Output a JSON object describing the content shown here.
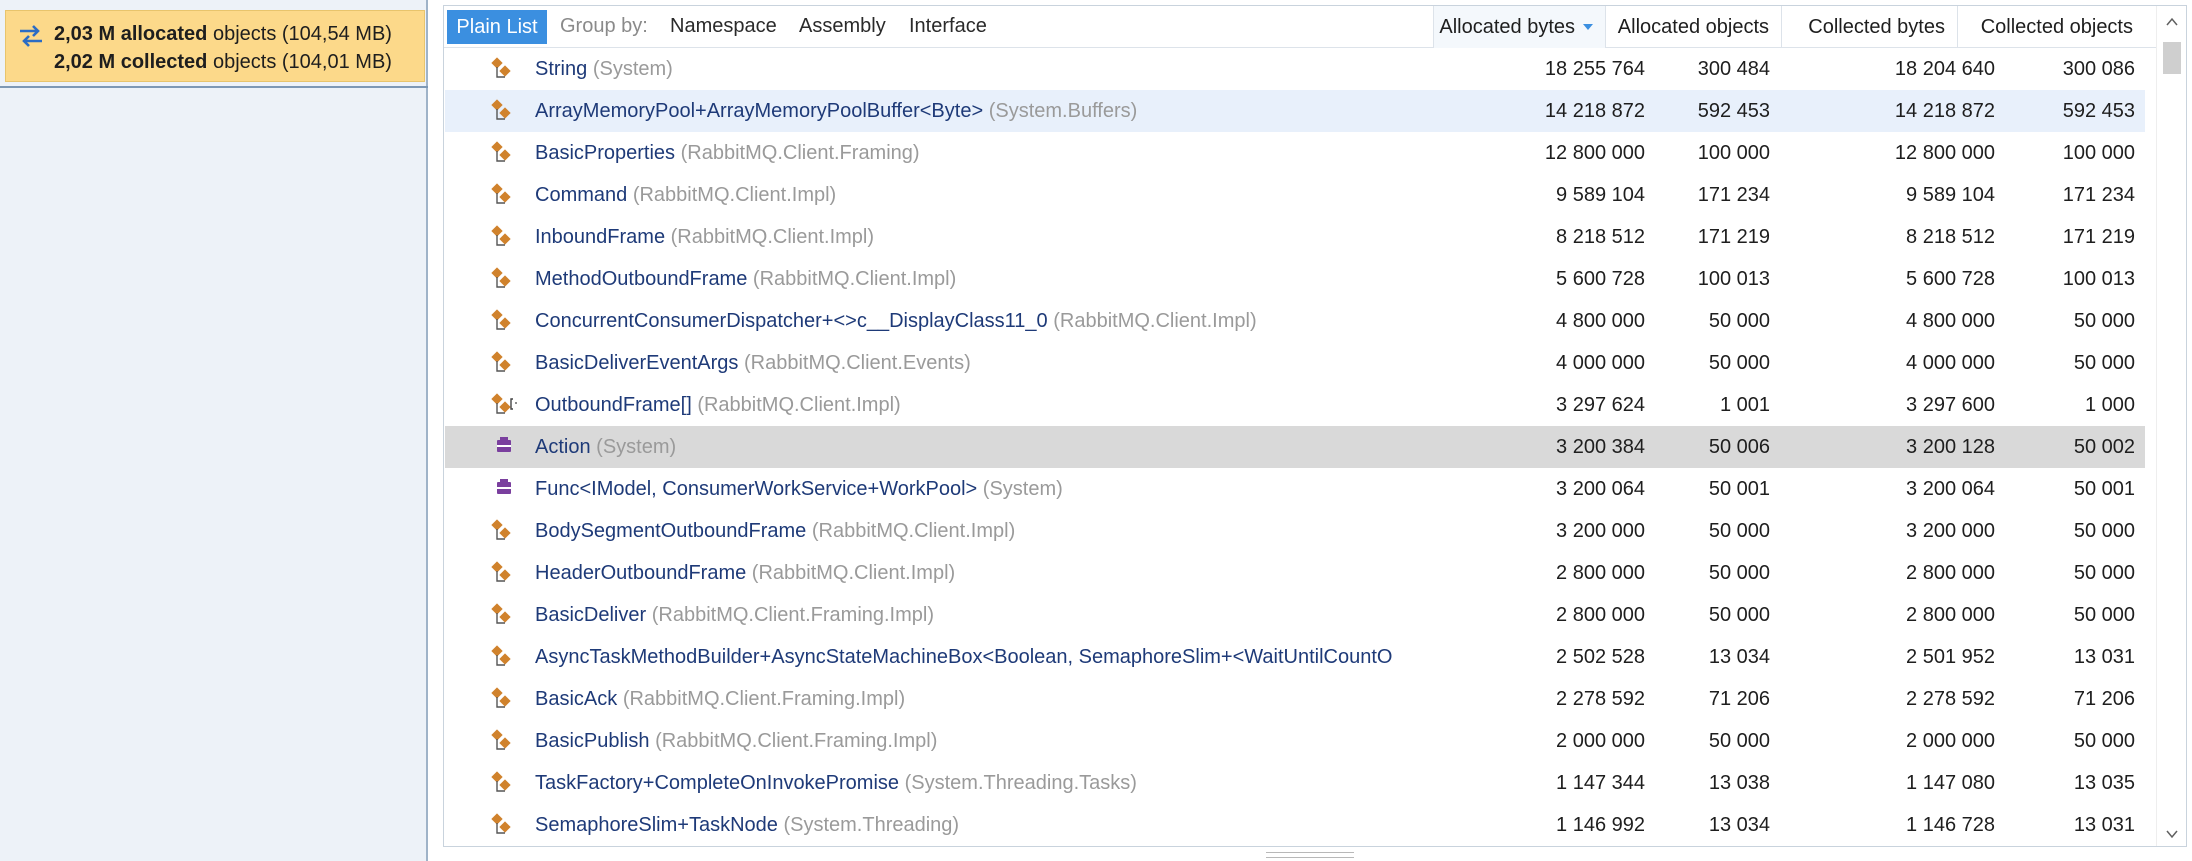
{
  "summary": {
    "allocated_count": "2,03 M allocated",
    "allocated_rest": " objects (104,54 MB)",
    "collected_count": "2,02 M collected",
    "collected_rest": " objects (104,01 MB)"
  },
  "toolbar": {
    "plain_list": "Plain List",
    "group_by": "Group by:",
    "namespace": "Namespace",
    "assembly": "Assembly",
    "interface": "Interface"
  },
  "columns": {
    "allocated_bytes": "Allocated bytes",
    "allocated_objects": "Allocated objects",
    "collected_bytes": "Collected bytes",
    "collected_objects": "Collected objects"
  },
  "colors": {
    "accent": "#3b8fe0",
    "summary_bg": "#fcd98a",
    "selected_row": "#d9d9d9",
    "hover_row": "#e8f0fb",
    "class_icon": "#d0822c",
    "delegate_icon": "#7a3f9e"
  },
  "rows": [
    {
      "name": "String",
      "ns": "(System)",
      "ab": "18 255 764",
      "ao": "300 484",
      "cb": "18 204 640",
      "co": "300 086",
      "icon": "class-icon"
    },
    {
      "name": "ArrayMemoryPool+ArrayMemoryPoolBuffer<Byte>",
      "ns": "(System.Buffers)",
      "ab": "14 218 872",
      "ao": "592 453",
      "cb": "14 218 872",
      "co": "592 453",
      "icon": "class-icon"
    },
    {
      "name": "BasicProperties",
      "ns": "(RabbitMQ.Client.Framing)",
      "ab": "12 800 000",
      "ao": "100 000",
      "cb": "12 800 000",
      "co": "100 000",
      "icon": "class-icon"
    },
    {
      "name": "Command",
      "ns": "(RabbitMQ.Client.Impl)",
      "ab": "9 589 104",
      "ao": "171 234",
      "cb": "9 589 104",
      "co": "171 234",
      "icon": "class-icon"
    },
    {
      "name": "InboundFrame",
      "ns": "(RabbitMQ.Client.Impl)",
      "ab": "8 218 512",
      "ao": "171 219",
      "cb": "8 218 512",
      "co": "171 219",
      "icon": "class-icon"
    },
    {
      "name": "MethodOutboundFrame",
      "ns": "(RabbitMQ.Client.Impl)",
      "ab": "5 600 728",
      "ao": "100 013",
      "cb": "5 600 728",
      "co": "100 013",
      "icon": "class-icon"
    },
    {
      "name": "ConcurrentConsumerDispatcher+<>c__DisplayClass11_0",
      "ns": "(RabbitMQ.Client.Impl)",
      "ab": "4 800 000",
      "ao": "50 000",
      "cb": "4 800 000",
      "co": "50 000",
      "icon": "class-icon"
    },
    {
      "name": "BasicDeliverEventArgs",
      "ns": "(RabbitMQ.Client.Events)",
      "ab": "4 000 000",
      "ao": "50 000",
      "cb": "4 000 000",
      "co": "50 000",
      "icon": "class-icon"
    },
    {
      "name": "OutboundFrame[]",
      "ns": "(RabbitMQ.Client.Impl)",
      "ab": "3 297 624",
      "ao": "1 001",
      "cb": "3 297 600",
      "co": "1 000",
      "icon": "array-icon"
    },
    {
      "name": "Action",
      "ns": "(System)",
      "ab": "3 200 384",
      "ao": "50 006",
      "cb": "3 200 128",
      "co": "50 002",
      "icon": "delegate-icon"
    },
    {
      "name": "Func<IModel, ConsumerWorkService+WorkPool>",
      "ns": "(System)",
      "ab": "3 200 064",
      "ao": "50 001",
      "cb": "3 200 064",
      "co": "50 001",
      "icon": "delegate-icon"
    },
    {
      "name": "BodySegmentOutboundFrame",
      "ns": "(RabbitMQ.Client.Impl)",
      "ab": "3 200 000",
      "ao": "50 000",
      "cb": "3 200 000",
      "co": "50 000",
      "icon": "class-icon"
    },
    {
      "name": "HeaderOutboundFrame",
      "ns": "(RabbitMQ.Client.Impl)",
      "ab": "2 800 000",
      "ao": "50 000",
      "cb": "2 800 000",
      "co": "50 000",
      "icon": "class-icon"
    },
    {
      "name": "BasicDeliver",
      "ns": "(RabbitMQ.Client.Framing.Impl)",
      "ab": "2 800 000",
      "ao": "50 000",
      "cb": "2 800 000",
      "co": "50 000",
      "icon": "class-icon"
    },
    {
      "name": "AsyncTaskMethodBuilder+AsyncStateMachineBox<Boolean, SemaphoreSlim+<WaitUntilCountO",
      "ns": "",
      "ab": "2 502 528",
      "ao": "13 034",
      "cb": "2 501 952",
      "co": "13 031",
      "icon": "class-icon"
    },
    {
      "name": "BasicAck",
      "ns": "(RabbitMQ.Client.Framing.Impl)",
      "ab": "2 278 592",
      "ao": "71 206",
      "cb": "2 278 592",
      "co": "71 206",
      "icon": "class-icon"
    },
    {
      "name": "BasicPublish",
      "ns": "(RabbitMQ.Client.Framing.Impl)",
      "ab": "2 000 000",
      "ao": "50 000",
      "cb": "2 000 000",
      "co": "50 000",
      "icon": "class-icon"
    },
    {
      "name": "TaskFactory+CompleteOnInvokePromise",
      "ns": "(System.Threading.Tasks)",
      "ab": "1 147 344",
      "ao": "13 038",
      "cb": "1 147 080",
      "co": "13 035",
      "icon": "class-icon"
    },
    {
      "name": "SemaphoreSlim+TaskNode",
      "ns": "(System.Threading)",
      "ab": "1 146 992",
      "ao": "13 034",
      "cb": "1 146 728",
      "co": "13 031",
      "icon": "class-icon"
    }
  ],
  "selected_row": 9,
  "hover_row": 1
}
